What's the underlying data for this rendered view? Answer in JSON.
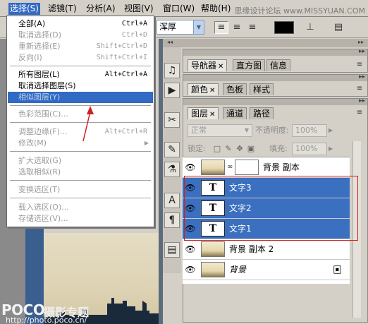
{
  "menubar": {
    "items": [
      "选择(S)",
      "滤镜(T)",
      "分析(A)",
      "视图(V)",
      "窗口(W)",
      "帮助(H)"
    ],
    "watermark": "思缘设计论坛 www.MISSYUAN.COM"
  },
  "options": {
    "antialias": "浑厚"
  },
  "select_menu": {
    "items": [
      {
        "label": "全部(A)",
        "shortcut": "Ctrl+A"
      },
      {
        "label": "取消选择(D)",
        "shortcut": "Ctrl+D"
      },
      {
        "label": "重新选择(E)",
        "shortcut": "Shift+Ctrl+D"
      },
      {
        "label": "反向(I)",
        "shortcut": "Shift+Ctrl+I"
      },
      {
        "label": "所有图层(L)",
        "shortcut": "Alt+Ctrl+A"
      },
      {
        "label": "取消选择图层(S)",
        "shortcut": ""
      },
      {
        "label": "相似图层(Y)",
        "shortcut": ""
      },
      {
        "label": "色彩范围(C)...",
        "shortcut": ""
      },
      {
        "label": "调整边缘(F)...",
        "shortcut": "Alt+Ctrl+R"
      },
      {
        "label": "修改(M)",
        "shortcut": ""
      },
      {
        "label": "扩大选取(G)",
        "shortcut": ""
      },
      {
        "label": "选取相似(R)",
        "shortcut": ""
      },
      {
        "label": "变换选区(T)",
        "shortcut": ""
      },
      {
        "label": "载入选区(O)...",
        "shortcut": ""
      },
      {
        "label": "存储选区(V)...",
        "shortcut": ""
      }
    ]
  },
  "panels": {
    "nav_tabs": [
      "导航器",
      "直方图",
      "信息"
    ],
    "color_tabs": [
      "颜色",
      "色板",
      "样式"
    ],
    "layers_tabs": [
      "图层",
      "通道",
      "路径"
    ],
    "blend_mode": "正常",
    "opacity_label": "不透明度:",
    "opacity_value": "100%",
    "lock_label": "锁定:",
    "fill_label": "填充:",
    "fill_value": "100%"
  },
  "layers": [
    {
      "name": "背景 副本",
      "type": "image-masked",
      "selected": false
    },
    {
      "name": "文字3",
      "type": "text",
      "selected": true
    },
    {
      "name": "文字2",
      "type": "text",
      "selected": true
    },
    {
      "name": "文字1",
      "type": "text",
      "selected": true
    },
    {
      "name": "背景 副本 2",
      "type": "image",
      "selected": false
    },
    {
      "name": "背景",
      "type": "image-locked",
      "selected": false
    }
  ],
  "watermark_bottom": {
    "logo": "POCO",
    "title": "摄影专题",
    "url": "http://photo.poco.cn/"
  },
  "colors": {
    "highlight": "#316ac5",
    "selected_layer": "#3b6fbf",
    "annotation": "#d02020"
  }
}
